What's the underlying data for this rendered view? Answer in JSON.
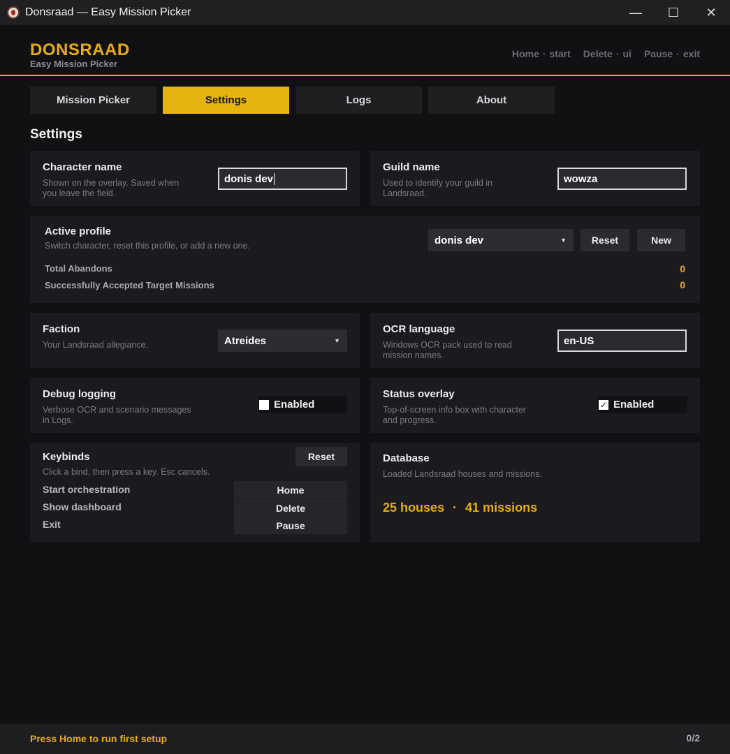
{
  "window": {
    "title": "Donsraad — Easy Mission Picker",
    "minimize_glyph": "—",
    "maximize_glyph": "☐",
    "close_glyph": "✕"
  },
  "header": {
    "brand": "DONSRAAD",
    "subtitle": "Easy Mission Picker",
    "hotkeys": [
      {
        "key": "Home",
        "action": "start"
      },
      {
        "key": "Delete",
        "action": "ui"
      },
      {
        "key": "Pause",
        "action": "exit"
      }
    ],
    "separator": "·"
  },
  "tabs": [
    {
      "label": "Mission Picker",
      "active": false
    },
    {
      "label": "Settings",
      "active": true
    },
    {
      "label": "Logs",
      "active": false
    },
    {
      "label": "About",
      "active": false
    }
  ],
  "page_title": "Settings",
  "character": {
    "title": "Character name",
    "desc_line1": "Shown on the overlay. Saved when",
    "desc_line2": "you leave the field.",
    "value": "donis dev"
  },
  "guild": {
    "title": "Guild name",
    "desc_line1": "Used to identify your guild in",
    "desc_line2": "Landsraad.",
    "value": "wowza"
  },
  "profile": {
    "title": "Active profile",
    "desc": "Switch character, reset this profile, or add a new one.",
    "selected": "donis dev",
    "reset_label": "Reset",
    "new_label": "New",
    "stats": [
      {
        "label": "Total Abandons",
        "value": "0"
      },
      {
        "label": "Successfully Accepted Target Missions",
        "value": "0"
      }
    ]
  },
  "faction": {
    "title": "Faction",
    "desc": "Your Landsraad allegiance.",
    "selected": "Atreides"
  },
  "ocr": {
    "title": "OCR language",
    "desc_line1": "Windows OCR pack used to read",
    "desc_line2": "mission names.",
    "value": "en-US"
  },
  "debug": {
    "title": "Debug logging",
    "desc_line1": "Verbose OCR and scenario messages",
    "desc_line2": "in Logs.",
    "toggle_label": "Enabled",
    "checked": false
  },
  "overlay": {
    "title": "Status overlay",
    "desc_line1": "Top-of-screen info box with character",
    "desc_line2": "and progress.",
    "toggle_label": "Enabled",
    "checked": true,
    "check_glyph": "✓"
  },
  "keybinds": {
    "title": "Keybinds",
    "desc": "Click a bind, then press a key. Esc cancels.",
    "reset_label": "Reset",
    "items": [
      {
        "label": "Start orchestration",
        "key": "Home"
      },
      {
        "label": "Show dashboard",
        "key": "Delete"
      },
      {
        "label": "Exit",
        "key": "Pause"
      }
    ]
  },
  "database": {
    "title": "Database",
    "desc": "Loaded Landsraad houses and missions.",
    "houses": "25 houses",
    "separator": "·",
    "missions": "41 missions"
  },
  "footer": {
    "message": "Press Home to run first setup",
    "count": "0/2"
  },
  "colors": {
    "accent": "#e6ad13",
    "background": "#111114",
    "card": "#1b1b1f"
  }
}
